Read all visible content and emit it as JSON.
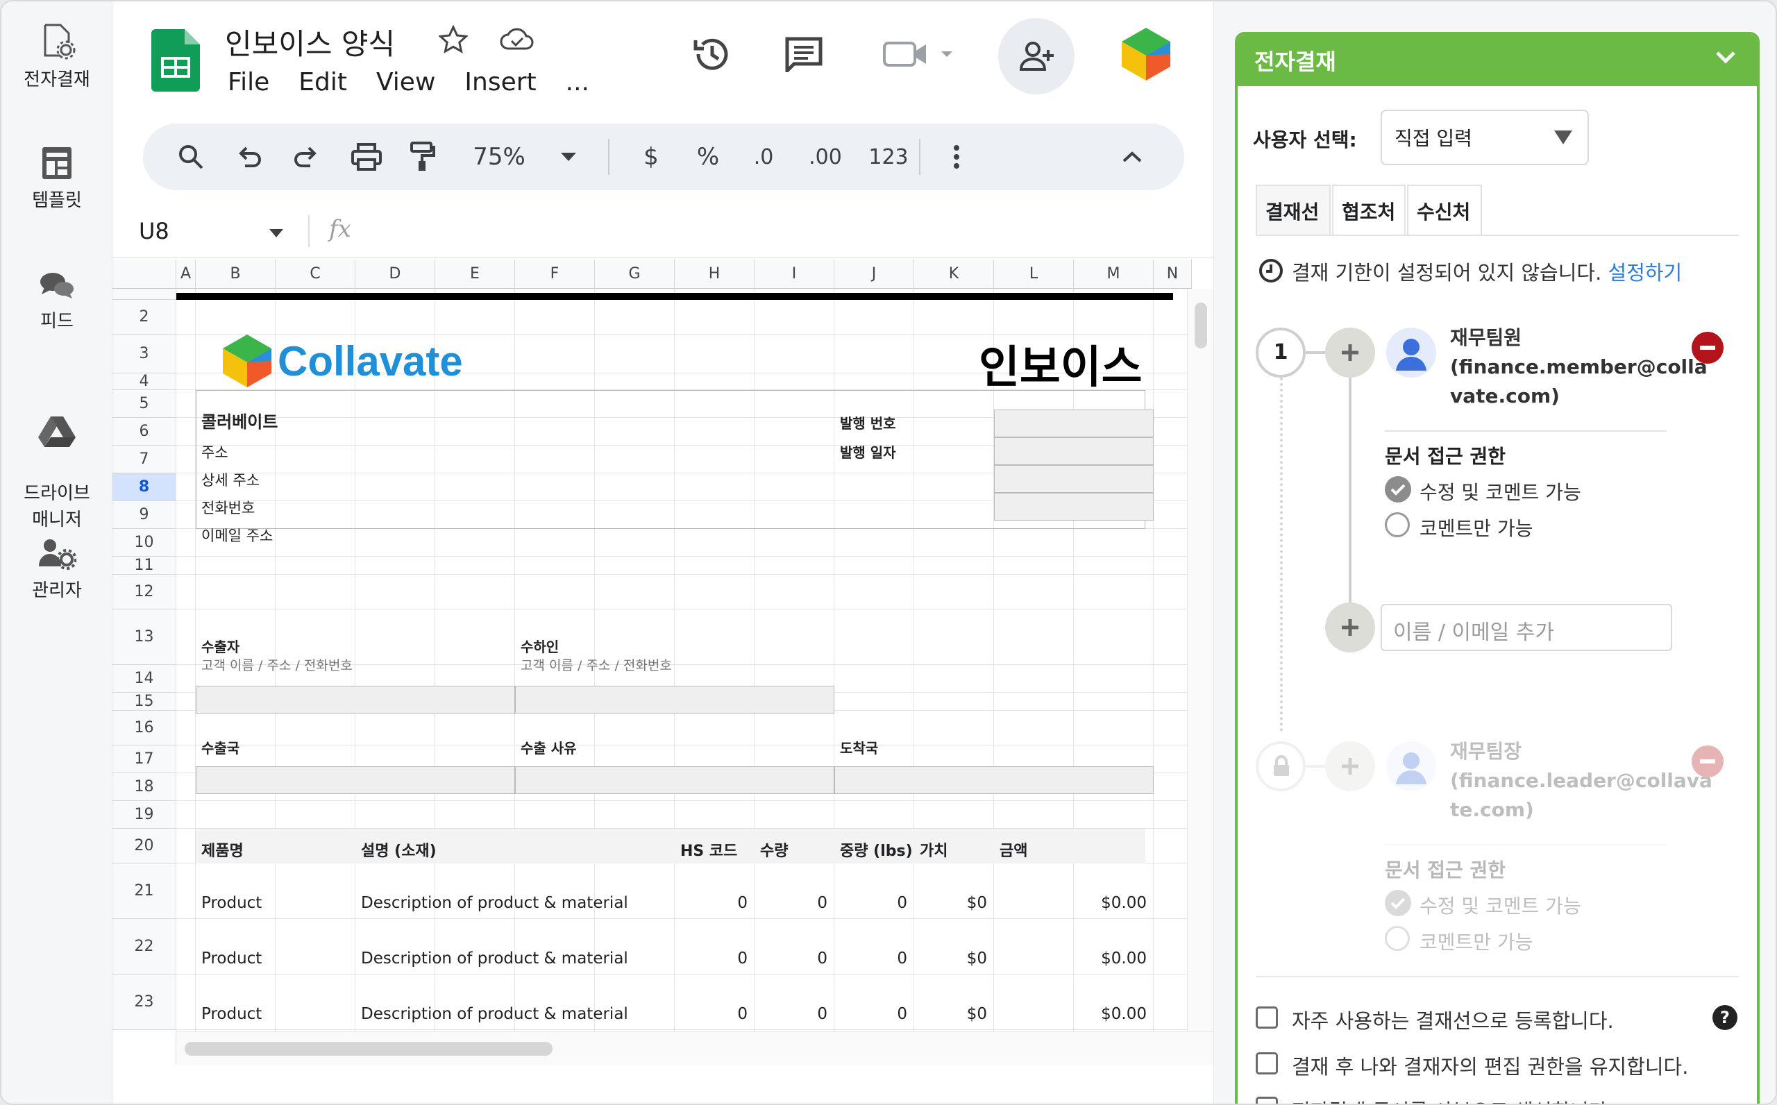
{
  "rail": {
    "items": [
      {
        "label": "전자결재",
        "icon": "document-settings-icon"
      },
      {
        "label": "템플릿",
        "icon": "template-icon"
      },
      {
        "label": "피드",
        "icon": "chat-bubbles-icon"
      },
      {
        "label": "드라이브\n매니저",
        "icon": "drive-icon"
      },
      {
        "label": "관리자",
        "icon": "admin-users-icon"
      }
    ]
  },
  "doc": {
    "title": "인보이스 양식",
    "menus": [
      "File",
      "Edit",
      "View",
      "Insert",
      "..."
    ]
  },
  "toolbar": {
    "zoom": "75%",
    "currency": "$",
    "percent": "%",
    "dec_less": ".0",
    "dec_more": ".00",
    "format_123": "123"
  },
  "formula": {
    "namebox": "U8",
    "fx": "fx",
    "value": ""
  },
  "grid": {
    "columns": [
      "A",
      "B",
      "C",
      "D",
      "E",
      "F",
      "G",
      "H",
      "I",
      "J",
      "K",
      "L",
      "M",
      "N"
    ],
    "rows": [
      "2",
      "3",
      "4",
      "5",
      "6",
      "7",
      "8",
      "9",
      "10",
      "11",
      "12",
      "13",
      "14",
      "15",
      "16",
      "17",
      "18",
      "19",
      "20",
      "21",
      "22",
      "23"
    ],
    "selected_row": "8"
  },
  "invoice": {
    "brand": "Collavate",
    "heading": "인보이스",
    "company": "콜러베이트",
    "address": "주소",
    "detail_address": "상세 주소",
    "phone": "전화번호",
    "email": "이메일 주소",
    "invoice_no": "발행 번호",
    "issue_date": "발행 일자",
    "exporter": "수출자",
    "exporter_sub": "고객 이름 / 주소 / 전화번호",
    "consignee": "수하인",
    "consignee_sub": "고객 이름 / 주소 / 전화번호",
    "export_country": "수출국",
    "export_reason": "수출 사유",
    "destination": "도착국",
    "table_headers": [
      "제품명",
      "설명 (소재)",
      "HS 코드",
      "수량",
      "중량 (lbs)",
      "가치",
      "금액"
    ],
    "items": [
      {
        "product": "Product",
        "desc": "Description of product & material",
        "hs": "0",
        "qty": "0",
        "weight": "0",
        "value": "$0",
        "amount": "$0.00"
      },
      {
        "product": "Product",
        "desc": "Description of product & material",
        "hs": "0",
        "qty": "0",
        "weight": "0",
        "value": "$0",
        "amount": "$0.00"
      },
      {
        "product": "Product",
        "desc": "Description of product & material",
        "hs": "0",
        "qty": "0",
        "weight": "0",
        "value": "$0",
        "amount": "$0.00"
      }
    ]
  },
  "panel": {
    "title": "전자결재",
    "user_select_label": "사용자 선택:",
    "user_select_value": "직접 입력",
    "tabs": [
      "결재선",
      "협조처",
      "수신처"
    ],
    "deadline_text": "결재 기한이 설정되어 있지 않습니다.",
    "deadline_link": "설정하기",
    "step_number": "1",
    "approver1": {
      "name": "재무팀원",
      "email1": "(finance.member@colla",
      "email2": "vate.com)"
    },
    "access_title": "문서 접근 권한",
    "access_edit": "수정 및 코멘트 가능",
    "access_comment": "코멘트만 가능",
    "add_placeholder": "이름 / 이메일 추가",
    "approver2": {
      "name": "재무팀장",
      "email1": "(finance.leader@collava",
      "email2": "te.com)"
    },
    "checkbox1": "자주 사용하는 결재선으로 등록합니다.",
    "checkbox2": "결재 후 나와 결재자의 편집 권한을 유지합니다.",
    "checkbox3": "전자결재 문서를 사본으로 생성합니다."
  },
  "colors": {
    "accent": "#6aba45",
    "sheets_green": "#0f9d58",
    "link": "#2a7de1",
    "remove_red": "#b3141b"
  }
}
